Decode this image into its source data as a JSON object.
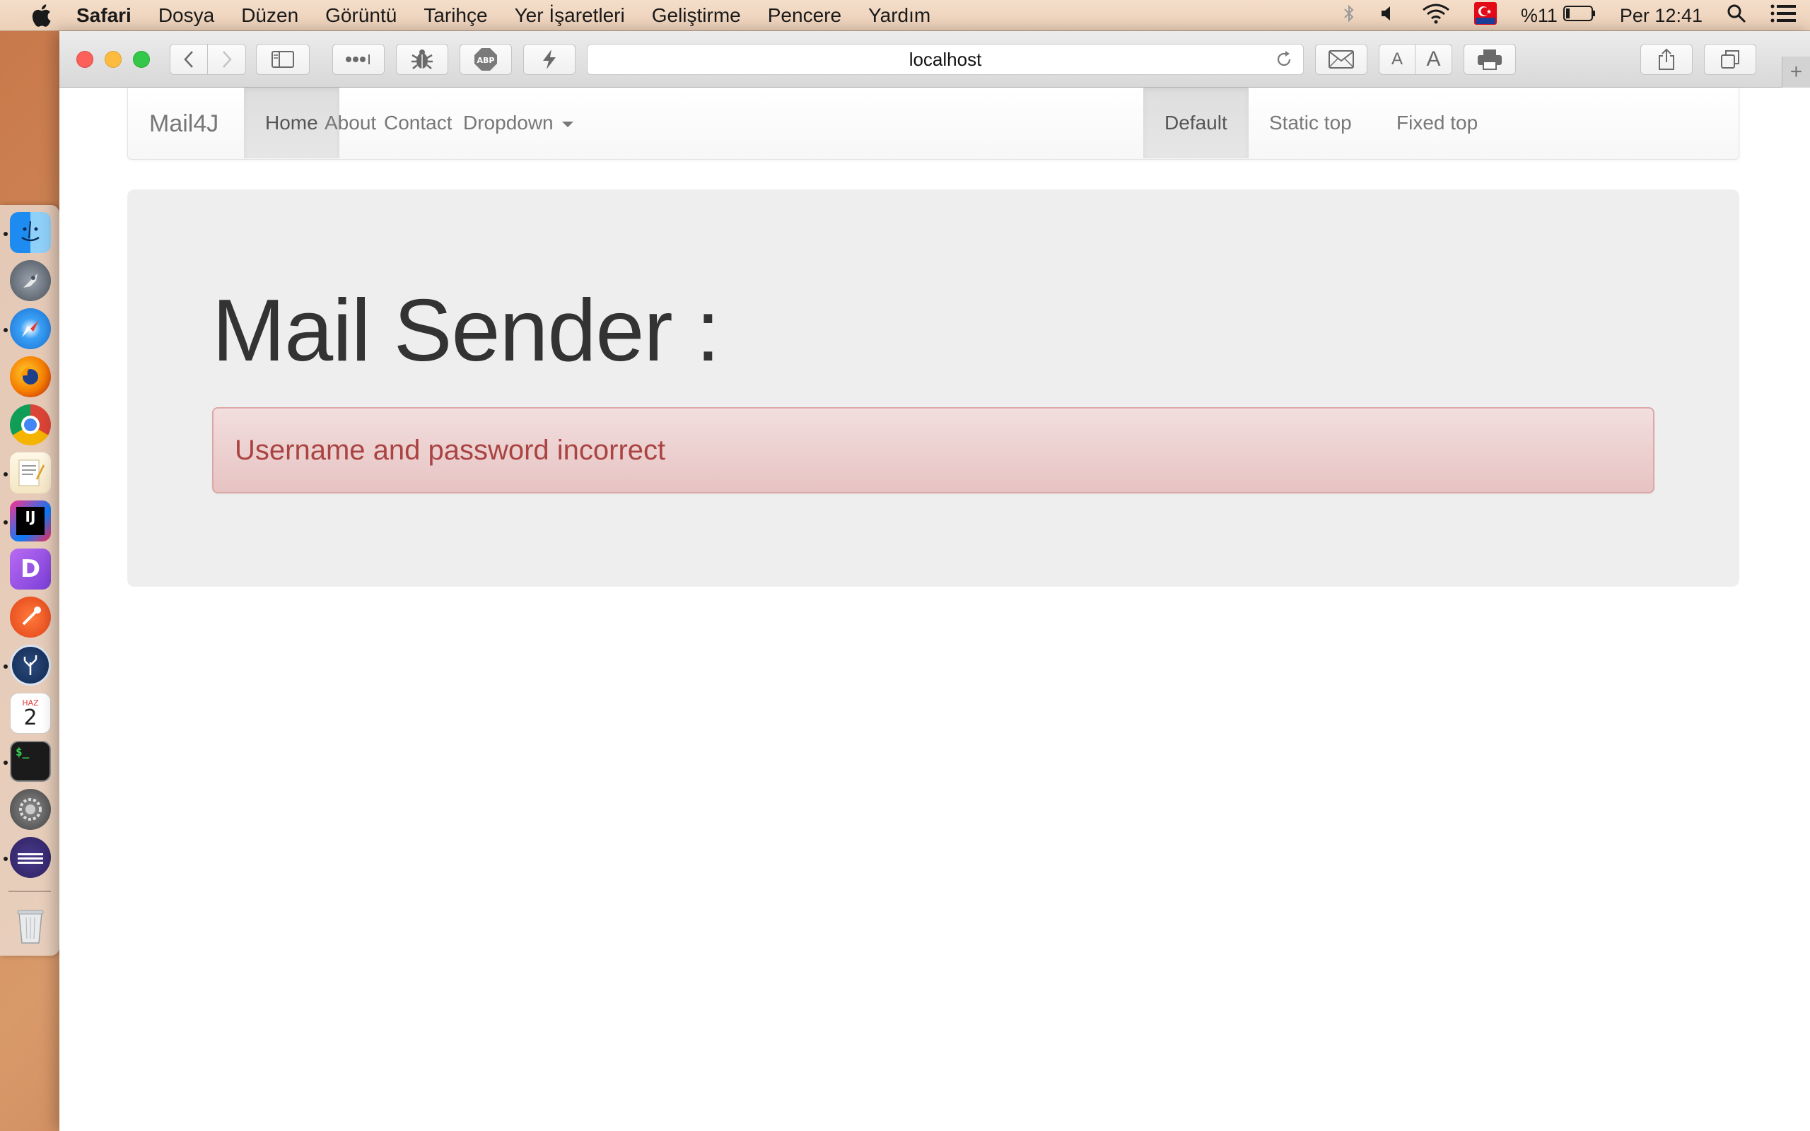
{
  "menubar": {
    "app_name": "Safari",
    "items": [
      "Dosya",
      "Düzen",
      "Görüntü",
      "Tarihçe",
      "Yer İşaretleri",
      "Geliştirme",
      "Pencere",
      "Yardım"
    ],
    "battery_text": "%11",
    "clock": "Per 12:41"
  },
  "dock": {
    "calendar_month": "HAZ",
    "calendar_day": "2",
    "intellij_label": "IJ",
    "deskapp_label": "D",
    "terminal_label": "$_"
  },
  "browser": {
    "url": "localhost",
    "font_small_label": "A",
    "font_large_label": "A",
    "new_tab_label": "+"
  },
  "navbar": {
    "brand": "Mail4J",
    "left_items": [
      "Home",
      "About",
      "Contact",
      "Dropdown"
    ],
    "right_items": [
      "Default",
      "Static top",
      "Fixed top"
    ]
  },
  "jumbotron": {
    "heading": "Mail Sender :",
    "alert": "Username and password incorrect"
  },
  "colors": {
    "alert_text": "#a94442",
    "alert_bg": "#f2dede",
    "jumbotron_bg": "#eeeeee",
    "traffic_red": "#fc605b",
    "traffic_yellow": "#fdbc40",
    "traffic_green": "#34c84a"
  }
}
